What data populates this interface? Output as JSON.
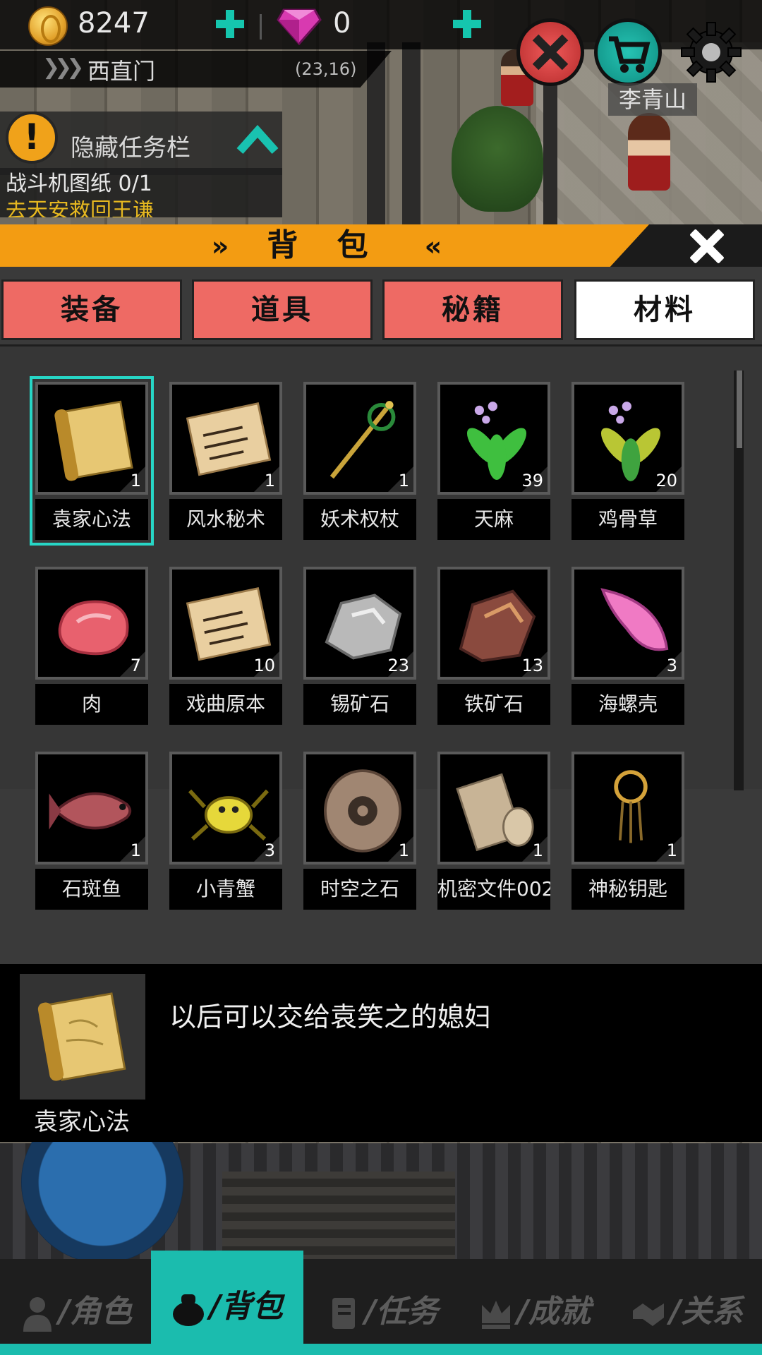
{
  "hud": {
    "coins": "8247",
    "gems": "0",
    "location": "西直门",
    "coord": "(23,16)",
    "npc_name": "李青山",
    "icons": [
      "coin-icon",
      "add-coin-icon",
      "gem-icon",
      "add-gem-icon",
      "battle-icon",
      "shop-icon",
      "gear-icon"
    ]
  },
  "quest": {
    "toggle_label": "隐藏任务栏",
    "line1": "战斗机图纸 0/1",
    "line2": "去天安救回王谦"
  },
  "bag": {
    "title": "背 包",
    "tabs": [
      {
        "label": "装备",
        "active": false
      },
      {
        "label": "道具",
        "active": false
      },
      {
        "label": "秘籍",
        "active": false
      },
      {
        "label": "材料",
        "active": true
      }
    ],
    "items": [
      {
        "name": "袁家心法",
        "count": "1",
        "icon": "scroll-icon",
        "selected": true
      },
      {
        "name": "风水秘术",
        "count": "1",
        "icon": "paper-icon"
      },
      {
        "name": "妖术权杖",
        "count": "1",
        "icon": "staff-icon"
      },
      {
        "name": "天麻",
        "count": "39",
        "icon": "herb-icon"
      },
      {
        "name": "鸡骨草",
        "count": "20",
        "icon": "herb-yellow-icon"
      },
      {
        "name": "肉",
        "count": "7",
        "icon": "meat-icon"
      },
      {
        "name": "戏曲原本",
        "count": "10",
        "icon": "paper-icon"
      },
      {
        "name": "锡矿石",
        "count": "23",
        "icon": "tin-ore-icon"
      },
      {
        "name": "铁矿石",
        "count": "13",
        "icon": "iron-ore-icon"
      },
      {
        "name": "海螺壳",
        "count": "3",
        "icon": "conch-icon"
      },
      {
        "name": "石斑鱼",
        "count": "1",
        "icon": "fish-icon"
      },
      {
        "name": "小青蟹",
        "count": "3",
        "icon": "crab-icon"
      },
      {
        "name": "时空之石",
        "count": "1",
        "icon": "stone-ring-icon"
      },
      {
        "name": "机密文件002",
        "count": "1",
        "icon": "rolled-paper-icon"
      },
      {
        "name": "神秘钥匙",
        "count": "1",
        "icon": "key-ring-icon"
      }
    ],
    "detail": {
      "name": "袁家心法",
      "description": "以后可以交给袁笑之的媳妇"
    }
  },
  "nav": [
    {
      "label": "/角色",
      "icon": "person-icon",
      "active": false
    },
    {
      "label": "/背包",
      "icon": "bag-icon",
      "active": true
    },
    {
      "label": "/任务",
      "icon": "quest-book-icon",
      "active": false
    },
    {
      "label": "/成就",
      "icon": "crown-icon",
      "active": false
    },
    {
      "label": "/关系",
      "icon": "handshake-icon",
      "active": false
    }
  ],
  "colors": {
    "accent": "#1bbcae",
    "tab": "#ee6a64",
    "title_bar": "#f39c12",
    "select": "#27d6c6"
  }
}
